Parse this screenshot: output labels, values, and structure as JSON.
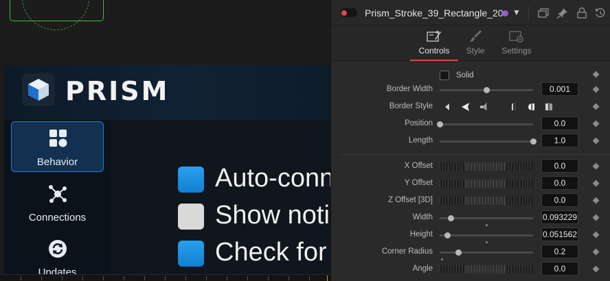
{
  "viewer": {
    "brand": "PRISM",
    "nav": [
      {
        "label": "Behavior",
        "icon": "grid-icon",
        "active": true
      },
      {
        "label": "Connections",
        "icon": "network-icon",
        "active": false
      },
      {
        "label": "Updates",
        "icon": "refresh-icon",
        "active": false
      }
    ],
    "options": [
      {
        "text": "Auto-conn",
        "checked": true
      },
      {
        "text": "Show noti",
        "checked": false
      },
      {
        "text": "Check for",
        "checked": true
      }
    ],
    "accent": "#1a8fe0"
  },
  "inspector": {
    "node_title": "Prism_Stroke_39_Rectangle_20",
    "toggle_color": "#e04848",
    "node_color": "#9b59d0",
    "tabs": [
      {
        "label": "Controls",
        "icon": "controls-icon",
        "active": true
      },
      {
        "label": "Style",
        "icon": "brush-icon",
        "active": false
      },
      {
        "label": "Settings",
        "icon": "settings-icon",
        "active": false
      }
    ],
    "solid_label": "Solid",
    "solid_checked": false,
    "params": {
      "border_width": {
        "label": "Border Width",
        "value": "0.001",
        "level": 0.5
      },
      "border_style": {
        "label": "Border Style"
      },
      "position": {
        "label": "Position",
        "value": "0.0",
        "level": 0.0
      },
      "length": {
        "label": "Length",
        "value": "1.0",
        "level": 1.0
      },
      "x_offset": {
        "label": "X Offset",
        "value": "0.0"
      },
      "y_offset": {
        "label": "Y Offset",
        "value": "0.0"
      },
      "z_offset": {
        "label": "Z Offset [3D]",
        "value": "0.0"
      },
      "width": {
        "label": "Width",
        "value": "0.093229",
        "level": 0.12
      },
      "height": {
        "label": "Height",
        "value": "0.051562",
        "level": 0.08
      },
      "corner_radius": {
        "label": "Corner Radius",
        "value": "0.2",
        "level": 0.2
      },
      "angle": {
        "label": "Angle",
        "value": "0.0"
      }
    }
  }
}
